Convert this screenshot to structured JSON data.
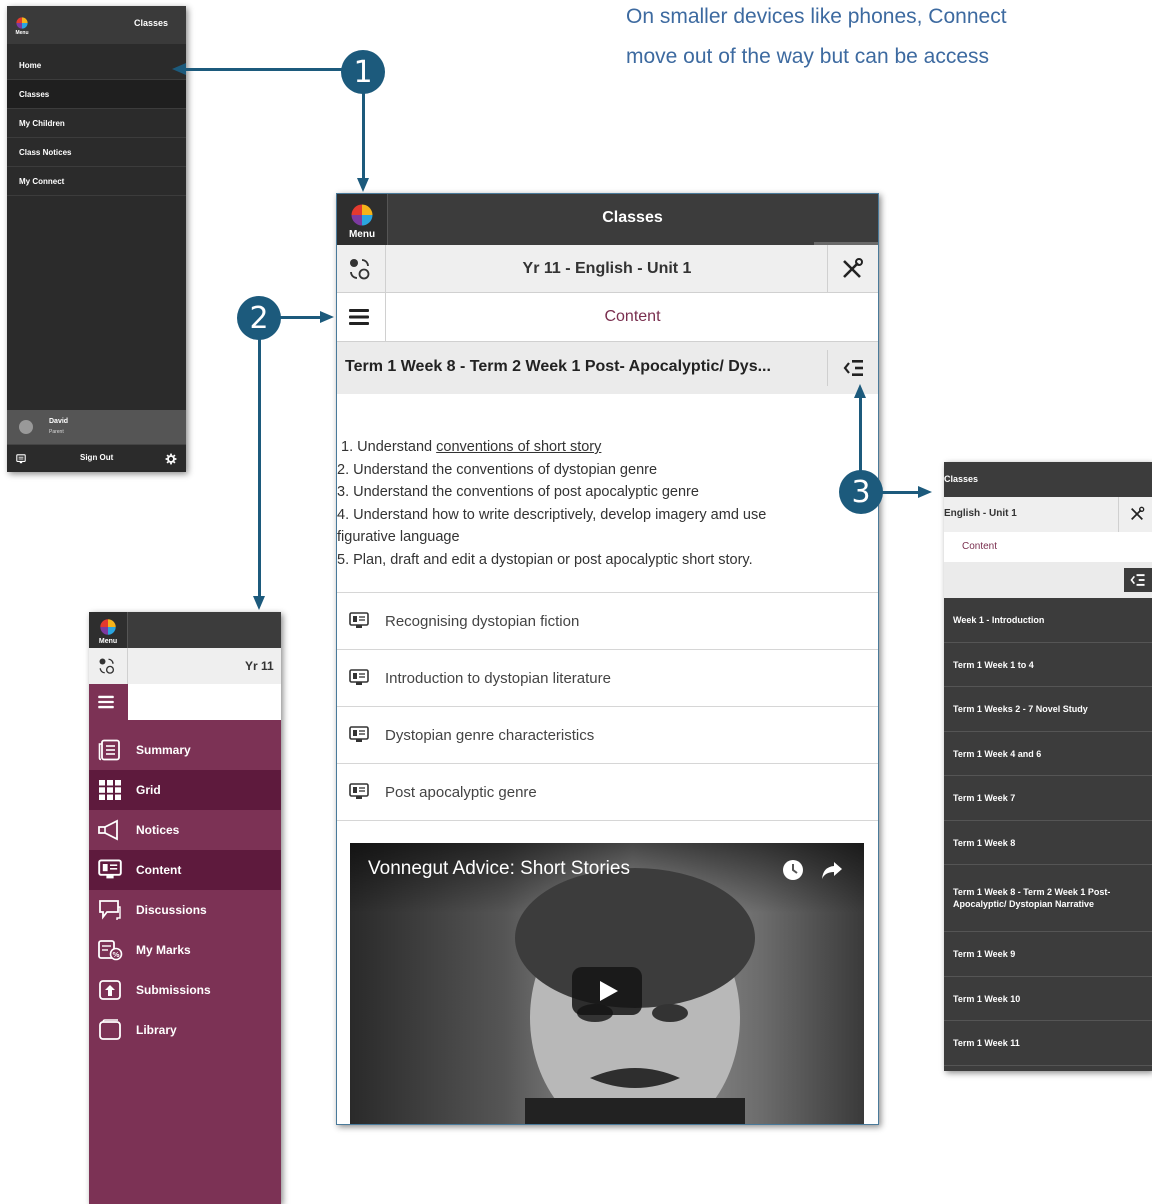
{
  "intro": {
    "line1": "On smaller devices like phones, Connect",
    "line2": "move out of the way but can be access"
  },
  "callouts": [
    "1",
    "2",
    "3"
  ],
  "colors": {
    "callout": "#1c5a7c",
    "menu_dark": "#2b2b2b",
    "class_menu": "#7c3255",
    "class_menu_active": "#5e1a3d",
    "content_accent": "#7a2f4f"
  },
  "main_menu": {
    "logo_label": "Menu",
    "title": "Classes",
    "items": [
      {
        "label": "Home"
      },
      {
        "label": "Classes"
      },
      {
        "label": "My Children"
      },
      {
        "label": "Class Notices"
      },
      {
        "label": "My Connect"
      }
    ],
    "user": {
      "name": "David",
      "role": "Parent"
    },
    "sign_out": "Sign Out"
  },
  "phone": {
    "logo_label": "Menu",
    "header_title": "Classes",
    "class_title": "Yr 11 - English - Unit 1",
    "section_title": "Content",
    "term_title": "Term 1 Week 8 - Term 2 Week 1 Post- Apocalyptic/ Dys...",
    "objectives": {
      "o1_prefix": "1. Understand ",
      "o1_link": "conventions of short story",
      "o2": "2. Understand the conventions of dystopian genre",
      "o3": "3. Understand the conventions of post apocalyptic genre",
      "o4a": "4. Understand how to write descriptively, develop imagery amd use",
      "o4b": "figurative language",
      "o5": "5. Plan, draft and edit a dystopian or post apocalyptic short story."
    },
    "items": [
      {
        "label": "Recognising dystopian fiction"
      },
      {
        "label": "Introduction to dystopian literature"
      },
      {
        "label": "Dystopian genre characteristics"
      },
      {
        "label": "Post apocalyptic genre"
      }
    ],
    "video": {
      "title": "Vonnegut Advice: Short Stories"
    }
  },
  "class_menu": {
    "logo_label": "Menu",
    "class_title_partial": "Yr 11",
    "items": [
      {
        "label": "Summary",
        "icon": "summary-icon"
      },
      {
        "label": "Grid",
        "icon": "grid-icon"
      },
      {
        "label": "Notices",
        "icon": "megaphone-icon"
      },
      {
        "label": "Content",
        "icon": "content-icon"
      },
      {
        "label": "Discussions",
        "icon": "discussion-icon"
      },
      {
        "label": "My Marks",
        "icon": "marks-icon"
      },
      {
        "label": "Submissions",
        "icon": "submission-icon"
      },
      {
        "label": "Library",
        "icon": "library-icon"
      }
    ]
  },
  "content_list": {
    "header_title": "Classes",
    "class_title_partial": "English - Unit 1",
    "section_title": "Content",
    "items": [
      {
        "label": "Week 1 - Introduction"
      },
      {
        "label": "Term 1 Week 1 to 4"
      },
      {
        "label": "Term 1 Weeks 2 - 7 Novel Study"
      },
      {
        "label": "Term 1 Week 4 and 6"
      },
      {
        "label": "Term 1 Week 7"
      },
      {
        "label": "Term 1 Week 8"
      },
      {
        "label": "Term 1 Week 8 - Term 2 Week 1 Post- Apocalyptic/ Dystopian Narrative"
      },
      {
        "label": "Term 1 Week 9"
      },
      {
        "label": "Term 1 Week 10"
      },
      {
        "label": "Term 1 Week 11"
      }
    ]
  }
}
